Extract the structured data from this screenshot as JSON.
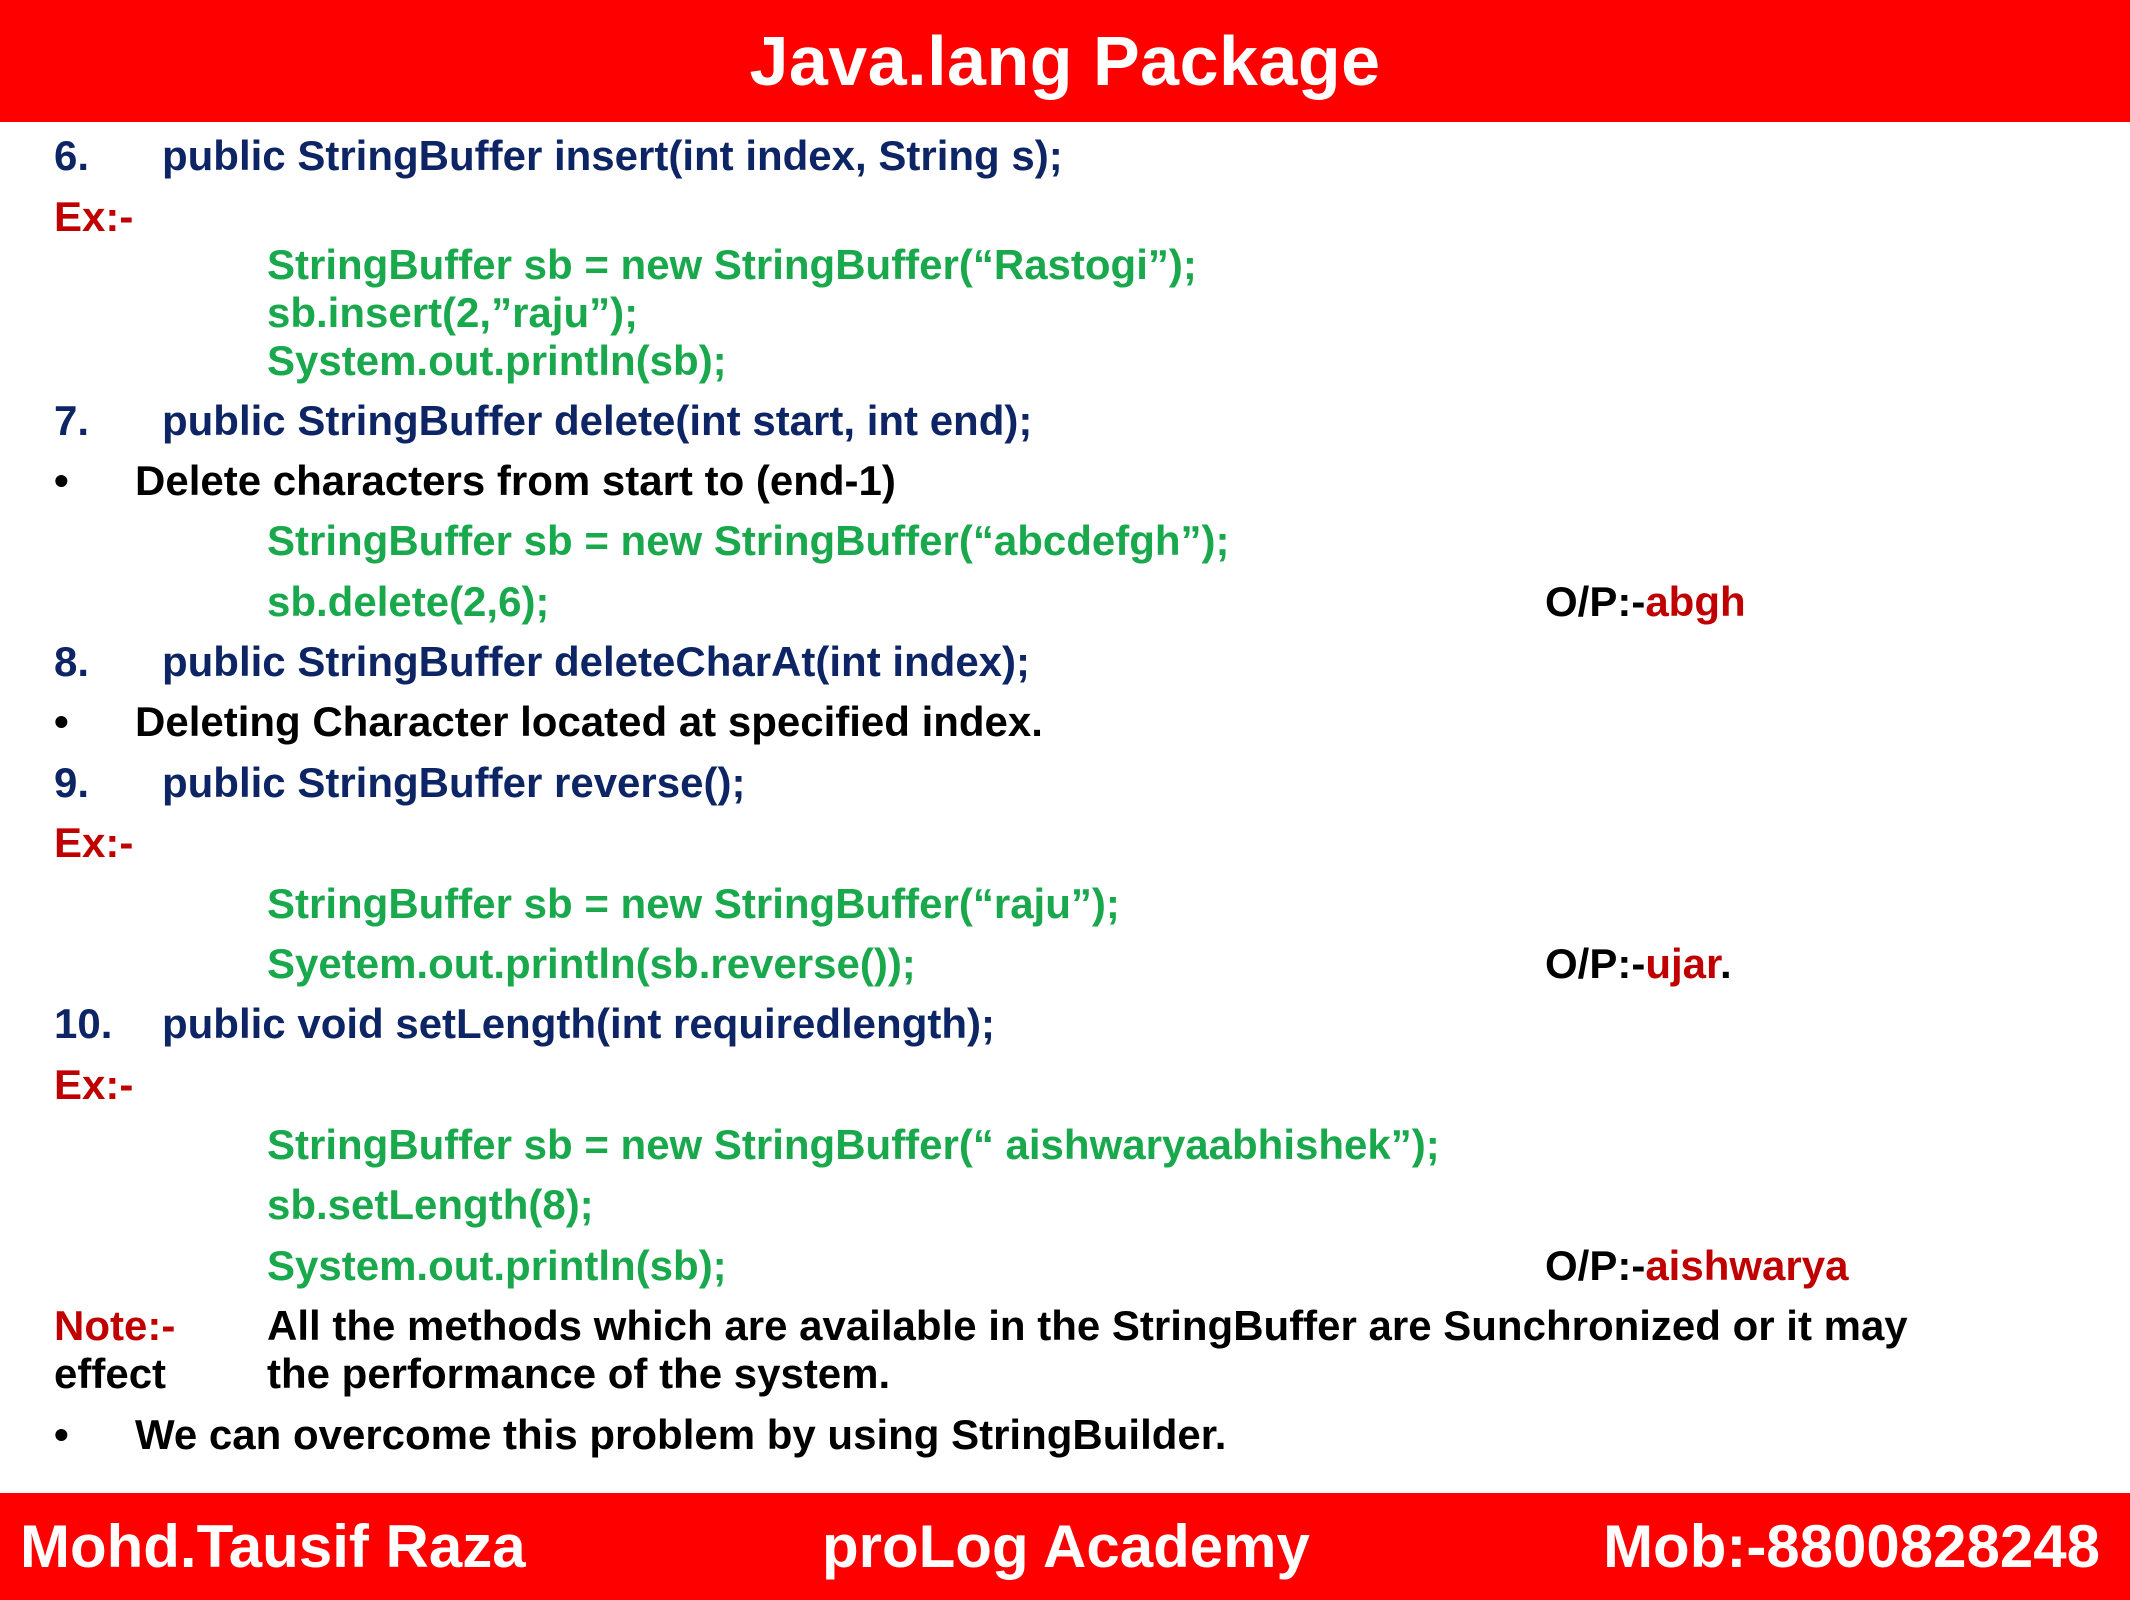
{
  "header": {
    "title": "Java.lang Package"
  },
  "items": [
    {
      "num": "6.",
      "sig": "public StringBuffer insert(int index, String s);"
    },
    {
      "num": "7.",
      "sig": "public StringBuffer delete(int start, int end);"
    },
    {
      "num": "8.",
      "sig": "public StringBuffer deleteCharAt(int index);"
    },
    {
      "num": "9.",
      "sig": "public StringBuffer reverse();"
    },
    {
      "num": "10.",
      "sig": "public void setLength(int requiredlength);"
    }
  ],
  "ex_label": "Ex:-",
  "bullet_char": "•",
  "insert_code": [
    "StringBuffer sb = new StringBuffer(“Rastogi”);",
    "sb.insert(2,”raju”);",
    "System.out.println(sb);"
  ],
  "delete_desc": "Delete characters from start to (end-1)",
  "delete_code": [
    "StringBuffer sb = new StringBuffer(“abcdefgh”);",
    "sb.delete(2,6);"
  ],
  "op_label": "O/P:-",
  "delete_output": "abgh",
  "deletechar_desc": "Deleting Character located at specified index.",
  "reverse_code": [
    "StringBuffer sb = new StringBuffer(“raju”);",
    "Syetem.out.println(sb.reverse());"
  ],
  "reverse_output": "ujar",
  "reverse_output_suffix": ".",
  "setlength_code": [
    "StringBuffer sb = new StringBuffer(“ aishwaryaabhishek”);",
    "sb.setLength(8);",
    "System.out.println(sb);"
  ],
  "setlength_output": "aishwarya",
  "note": {
    "label": "Note:-",
    "line1": "All the methods which are available in the StringBuffer are Sunchronized or it may",
    "continuation": "effect",
    "line2": "the performance of the system."
  },
  "final_bullet": "We can overcome this problem by using StringBuilder.",
  "footer": {
    "author": "Mohd.Tausif Raza",
    "academy": "proLog Academy",
    "mobile": "Mob:-8800828248"
  }
}
